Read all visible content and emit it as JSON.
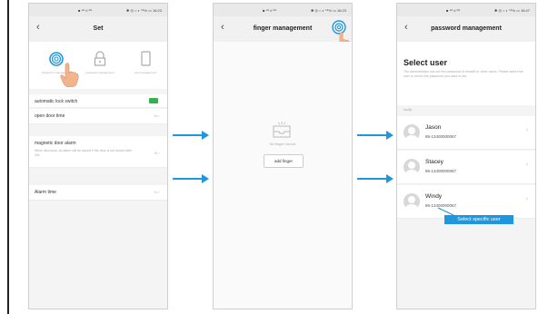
{
  "colors": {
    "accent": "#1f97dd",
    "toggle_on": "#33b14a"
  },
  "phone1": {
    "statusbar": {
      "left": "■ ⁴ᴳ ıl ⁵ᴳ",
      "right": "✱ ◎ ⌂ ◐ ⁵⁵% ▭ 16:23"
    },
    "title": "Set",
    "icons": [
      {
        "icon": "fingerprint-icon",
        "caption": "fingerprint management"
      },
      {
        "icon": "lock-icon",
        "caption": "password management"
      },
      {
        "icon": "card-icon",
        "caption": "card management"
      }
    ],
    "rows": {
      "auto_lock": "automatic lock switch",
      "open_door_time": "open door time",
      "open_door_value": "5s ›",
      "magnetic": "magnetic door alarm",
      "magnetic_desc": "When abnormal, an alarm will be issued if the door is not closed after 30s",
      "magnetic_value": "3s ›",
      "alarm_time": "Alarm time",
      "alarm_value": "1s ›"
    }
  },
  "phone2": {
    "statusbar": {
      "left": "■ ⁴ᴳ ıl ⁵ᴳ",
      "right": "✱ ◎ ⌂ ◐ ⁵⁵% ▭ 16:23"
    },
    "title": "finger management",
    "empty_text": "No finger record",
    "add_button": "add finger"
  },
  "phone3": {
    "statusbar": {
      "left": "■ ⁴ᴳ ıl ⁵ᴳ",
      "right": "✱ ◎ ⌂ ◐ ⁵⁵% ▭ 16:47"
    },
    "title": "password management",
    "select_title": "Select user",
    "select_desc": "The administrator can set the password of himself or other users. Please select the user to whom the password you want to set.",
    "section": "family",
    "users": [
      {
        "name": "Jason",
        "phone": "86-13400000067"
      },
      {
        "name": "Stacey",
        "phone": "86-13400000067"
      },
      {
        "name": "Windy",
        "phone": "86-13400000067"
      }
    ],
    "callout": "Select specific user"
  }
}
